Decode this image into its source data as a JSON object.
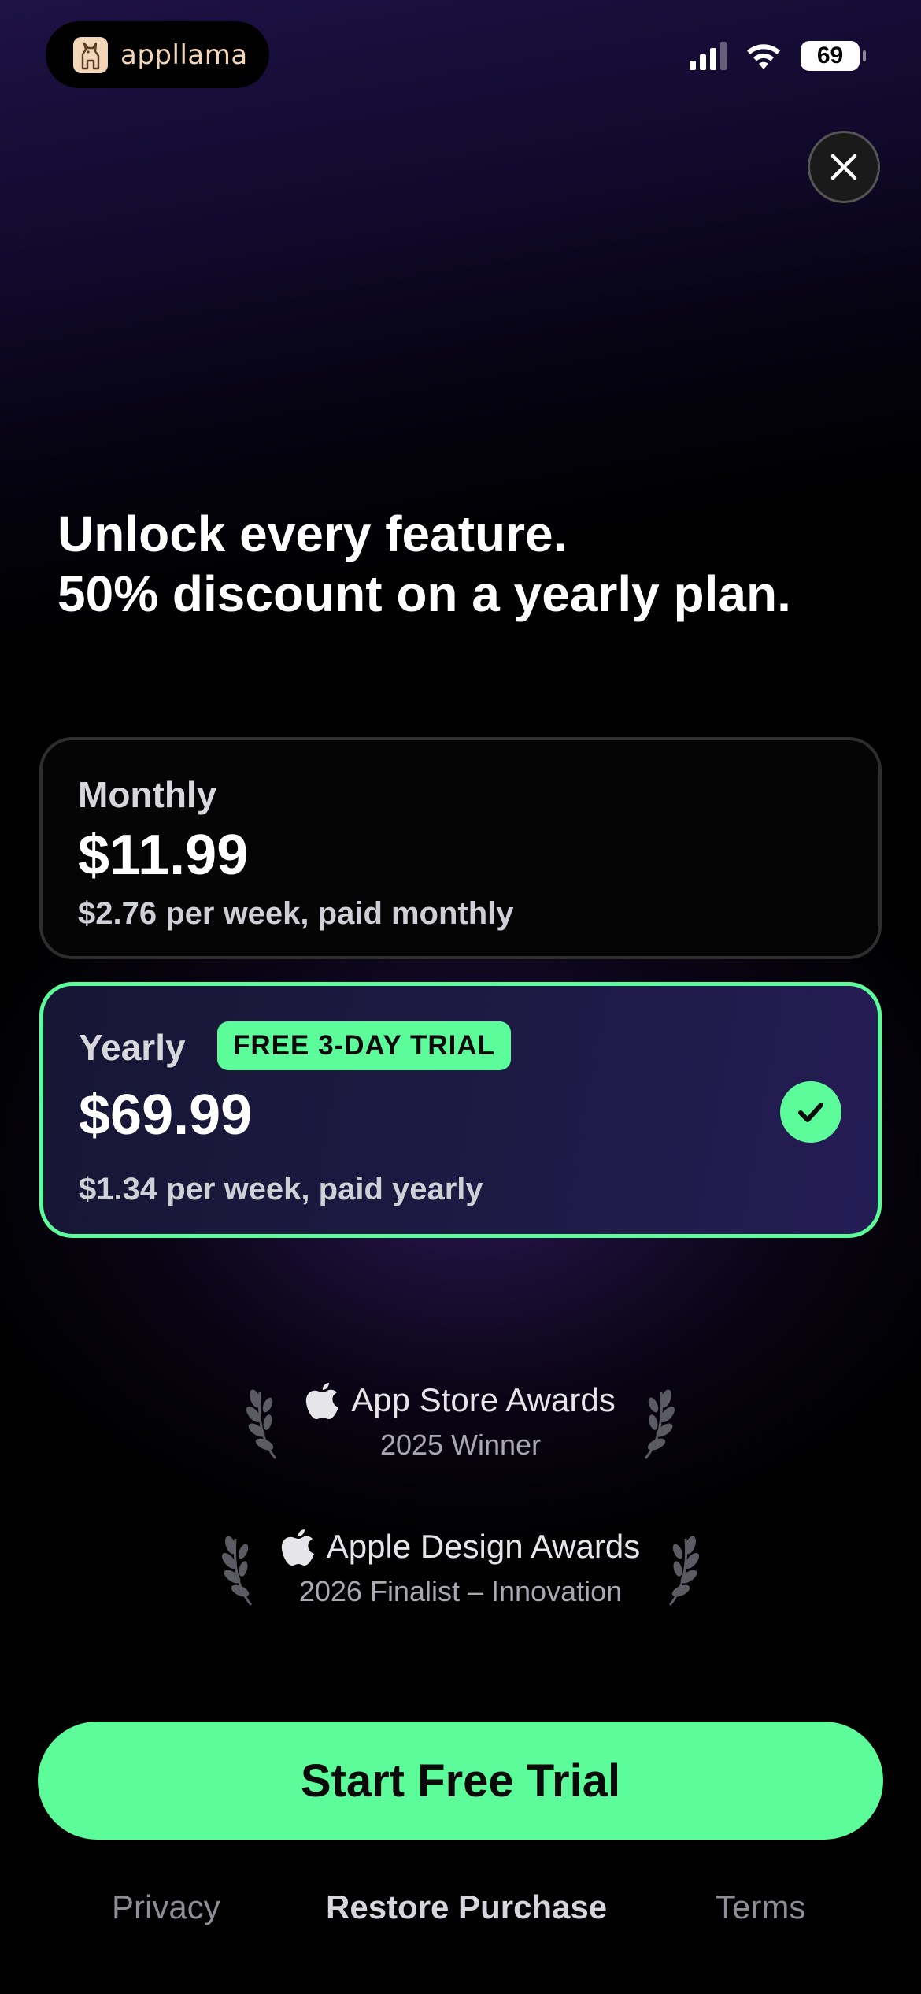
{
  "app": {
    "name": "appllama",
    "logo_icon": "llama-icon"
  },
  "status_bar": {
    "battery_level": "69",
    "signal_bars": 3,
    "wifi": true
  },
  "headline": {
    "line1": "Unlock every feature.",
    "line2": "50% discount on a yearly plan."
  },
  "plans": {
    "monthly": {
      "name": "Monthly",
      "price": "$11.99",
      "sub": "$2.76 per week, paid monthly",
      "selected": false
    },
    "yearly": {
      "name": "Yearly",
      "badge": "FREE 3-DAY TRIAL",
      "price": "$69.99",
      "sub": "$1.34 per week, paid yearly",
      "selected": true
    }
  },
  "awards": [
    {
      "title": "App Store Awards",
      "subtitle": "2025 Winner"
    },
    {
      "title": "Apple Design Awards",
      "subtitle": "2026 Finalist – Innovation"
    }
  ],
  "cta": {
    "label": "Start Free Trial"
  },
  "footer": {
    "privacy": "Privacy",
    "restore": "Restore Purchase",
    "terms": "Terms"
  },
  "colors": {
    "accent": "#5dfc9b",
    "background": "#000000",
    "card_selected_bg": "#1d1a44"
  }
}
